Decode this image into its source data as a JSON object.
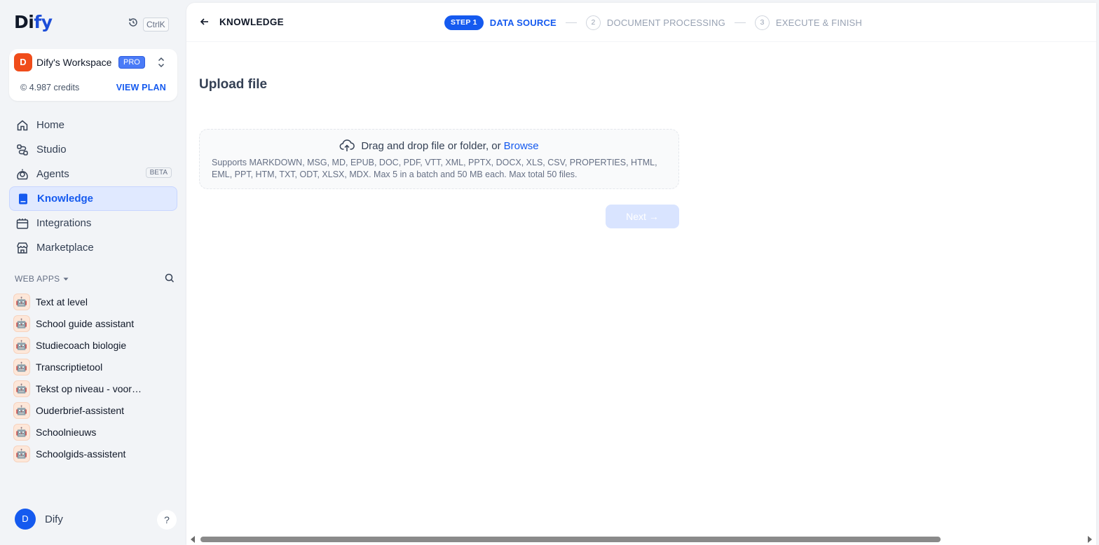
{
  "brand": {
    "logo_main": "Di",
    "logo_accent": "fy"
  },
  "shortcut": {
    "key": "CtrlK"
  },
  "workspace": {
    "avatar_letter": "D",
    "name": "Dify's Workspace",
    "plan_badge": "PRO",
    "credits": "4.987 credits",
    "credits_icon": "©",
    "view_plan": "VIEW PLAN"
  },
  "nav": {
    "home": "Home",
    "studio": "Studio",
    "agents": "Agents",
    "agents_badge": "BETA",
    "knowledge": "Knowledge",
    "integrations": "Integrations",
    "marketplace": "Marketplace"
  },
  "web_apps": {
    "label": "WEB APPS",
    "items": [
      "Text at level",
      "School guide assistant",
      "Studiecoach biologie",
      "Transcriptietool",
      "Tekst op niveau - voor…",
      "Ouderbrief-assistent",
      "Schoolnieuws",
      "Schoolgids-assistent"
    ]
  },
  "user": {
    "avatar_letter": "D",
    "name": "Dify",
    "help": "?"
  },
  "header": {
    "title": "KNOWLEDGE",
    "steps": {
      "step1_pill": "STEP 1",
      "step1_label": "DATA SOURCE",
      "step2_num": "2",
      "step2_label": "DOCUMENT PROCESSING",
      "step3_num": "3",
      "step3_label": "EXECUTE & FINISH"
    }
  },
  "upload": {
    "title": "Upload file",
    "drag_text": "Drag and drop file or folder, or",
    "browse": "Browse",
    "supports": "Supports MARKDOWN, MSG, MD, EPUB, DOC, PDF, VTT, XML, PPTX, DOCX, XLS, CSV, PROPERTIES, HTML, EML, PPT, HTM, TXT, ODT, XLSX, MDX. Max 5 in a batch and 50 MB each. Max total 50 files.",
    "next": "Next",
    "next_arrow": "→"
  },
  "colors": {
    "accent": "#155aef",
    "active_bg": "#e0e9ff",
    "avatar_orange": "#f04c1a"
  }
}
